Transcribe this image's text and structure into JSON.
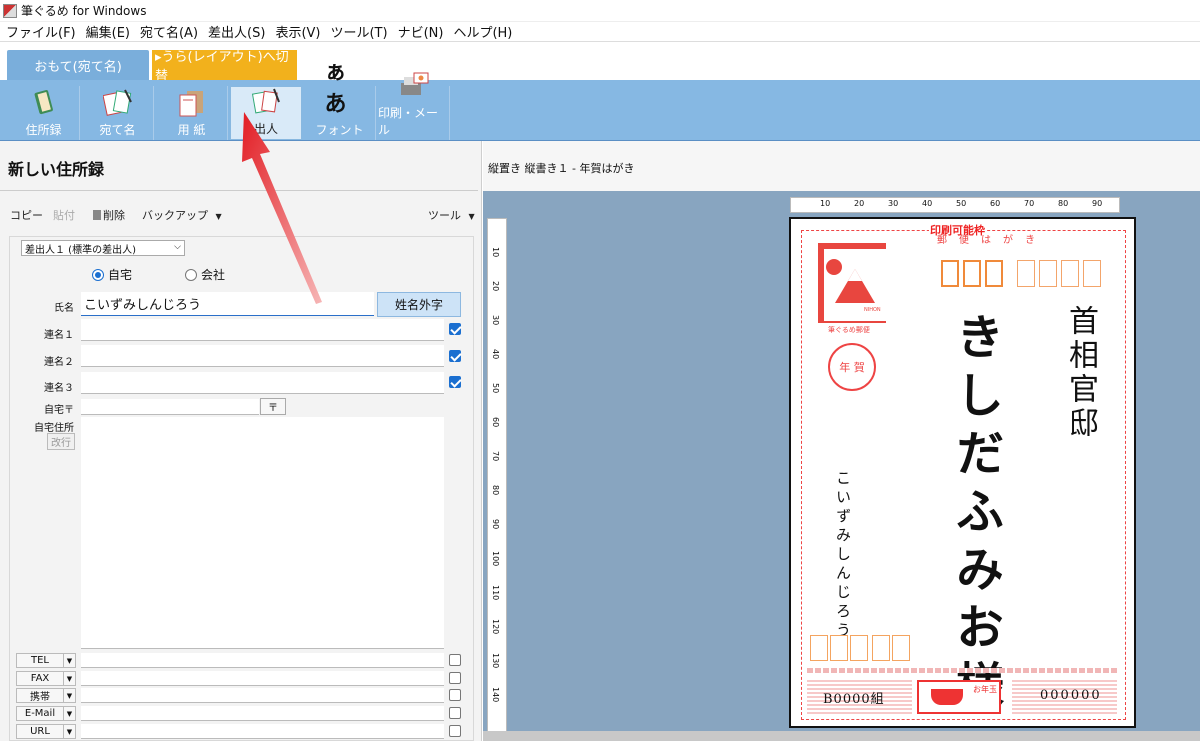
{
  "window": {
    "title": "筆ぐるめ for Windows"
  },
  "menu": [
    "ファイル(F)",
    "編集(E)",
    "宛て名(A)",
    "差出人(S)",
    "表示(V)",
    "ツール(T)",
    "ナビ(N)",
    "ヘルプ(H)"
  ],
  "tabs": {
    "front": "おもて(宛て名)",
    "back": "▸うら(レイアウト)へ切替"
  },
  "toolbar": [
    {
      "label": "住所録",
      "icon": "address-book-icon"
    },
    {
      "label": "宛て名",
      "icon": "address-card-icon"
    },
    {
      "label": "用 紙",
      "icon": "paper-icon"
    },
    {
      "label": "出人",
      "icon": "sender-icon",
      "selected": true
    },
    {
      "label": "フォント",
      "icon": "font-icon",
      "glyph": "ぁあ"
    },
    {
      "label": "印刷・メール",
      "icon": "printer-mail-icon"
    }
  ],
  "left": {
    "title": "新しい住所録",
    "tools": {
      "copy": "コピー",
      "paste": "貼付",
      "delete": "削除",
      "backup": "バックアップ",
      "tool": "ツール"
    },
    "sender_select": "差出人１ (標準の差出人)",
    "radio_home": "自宅",
    "radio_company": "会社",
    "labels": {
      "name": "氏名",
      "joint1": "連名１",
      "joint2": "連名２",
      "joint3": "連名３",
      "zip": "自宅〒",
      "address": "自宅住所"
    },
    "name_value": "こいずみしんじろう",
    "gaiji_button": "姓名外字",
    "zip_button": "〒",
    "newline_button": "改行",
    "contacts": [
      "TEL",
      "FAX",
      "携帯",
      "E-Mail",
      "URL"
    ]
  },
  "right": {
    "layout_title": "縦置き 縦書き１ - 年賀はがき",
    "printable_label": "印刷可能枠",
    "postcard_sub": "郵便はがき",
    "recipient_name": "きしだふみお様",
    "recipient_address": "首相官邸",
    "sender_name": "こいずみしんじろう",
    "stamp_caption": "筆ぐるめ郵便",
    "stamp_tag": "NIHON",
    "postmark": "年 賀",
    "lottery_left": "B0000組",
    "lottery_right": "000000",
    "lottery_tag": "お年玉",
    "hruler": [
      "10",
      "20",
      "30",
      "40",
      "50",
      "60",
      "70",
      "80",
      "90"
    ],
    "vruler": [
      "10",
      "20",
      "30",
      "40",
      "50",
      "60",
      "70",
      "80",
      "90",
      "100",
      "110",
      "120",
      "130",
      "140"
    ]
  },
  "colors": {
    "toolbar": "#86b8e3",
    "accent_tab": "#f2b11c",
    "front_tab": "#7aaedb",
    "postcard_red": "#e8463f"
  }
}
